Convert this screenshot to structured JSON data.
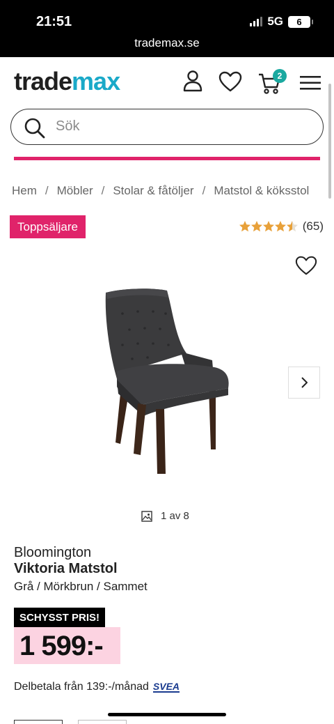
{
  "status_bar": {
    "time": "21:51",
    "network": "5G",
    "battery": "6",
    "url": "trademax.se"
  },
  "header": {
    "logo_part1": "trade",
    "logo_part2": "max",
    "cart_count": "2",
    "icons": [
      "user-icon",
      "heart-icon",
      "cart-icon",
      "menu-icon"
    ]
  },
  "search": {
    "placeholder": "Sök"
  },
  "breadcrumb": [
    "Hem",
    "Möbler",
    "Stolar & fåtöljer",
    "Matstol & köksstol"
  ],
  "badge": "Toppsäljare",
  "rating": {
    "stars": 4.5,
    "count": "(65)"
  },
  "gallery": {
    "counter": "1 av 8"
  },
  "product": {
    "brand": "Bloomington",
    "name": "Viktoria Matstol",
    "variant": "Grå / Mörkbrun / Sammet",
    "price_label": "SCHYSST PRIS!",
    "price": "1 599:-",
    "installment": "Delbetala från 139:-/månad",
    "payment_provider": "SVEA"
  },
  "colors": {
    "pink": "#e0236a",
    "teal": "#1aa9c8",
    "price_bg": "#fcd3e1",
    "star": "#e8a13a"
  }
}
